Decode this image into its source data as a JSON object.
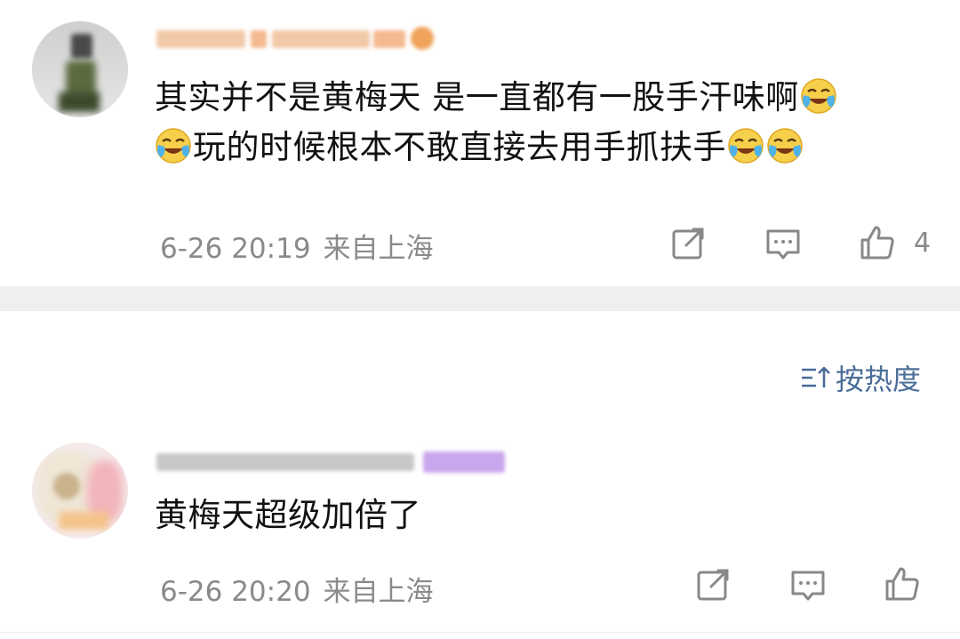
{
  "comments": [
    {
      "lines": [
        "其实并不是黄梅天 是一直都有一股手汗味啊",
        "玩的时候根本不敢直接去用手抓扶手"
      ],
      "time": "6-26 20:19",
      "location": "来自上海",
      "likes": "4"
    },
    {
      "lines": [
        "黄梅天超级加倍了"
      ],
      "time": "6-26 20:20",
      "location": "来自上海",
      "likes": ""
    }
  ],
  "sort": {
    "label": "按热度",
    "icon": "sort-icon"
  },
  "icons": {
    "share": "share-icon",
    "reply": "comment-icon",
    "like": "thumbs-up-icon",
    "emoji": "laugh-cry-emoji-icon"
  },
  "colors": {
    "meta": "#8a8a8a",
    "accent": "#4a6d99",
    "divider": "#efefef"
  }
}
